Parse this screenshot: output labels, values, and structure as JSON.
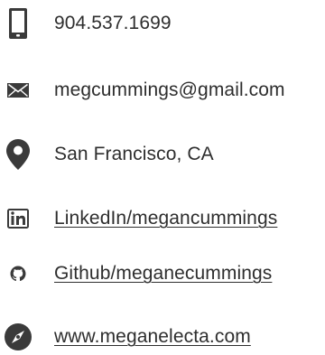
{
  "colors": {
    "icon": "#3a3a3a",
    "text": "#2e2e2e"
  },
  "contacts": [
    {
      "icon": "smartphone-icon",
      "text": "904.537.1699",
      "link": false
    },
    {
      "icon": "envelope-icon",
      "text": "megcummings@gmail.com",
      "link": false
    },
    {
      "icon": "map-pin-icon",
      "text": "San Francisco, CA",
      "link": false
    },
    {
      "icon": "linkedin-icon",
      "text": "LinkedIn/megancummings",
      "link": true
    },
    {
      "icon": "github-icon",
      "text": "Github/meganecummings",
      "link": true
    },
    {
      "icon": "compass-icon",
      "text": "www.meganelecta.com",
      "link": true
    }
  ]
}
